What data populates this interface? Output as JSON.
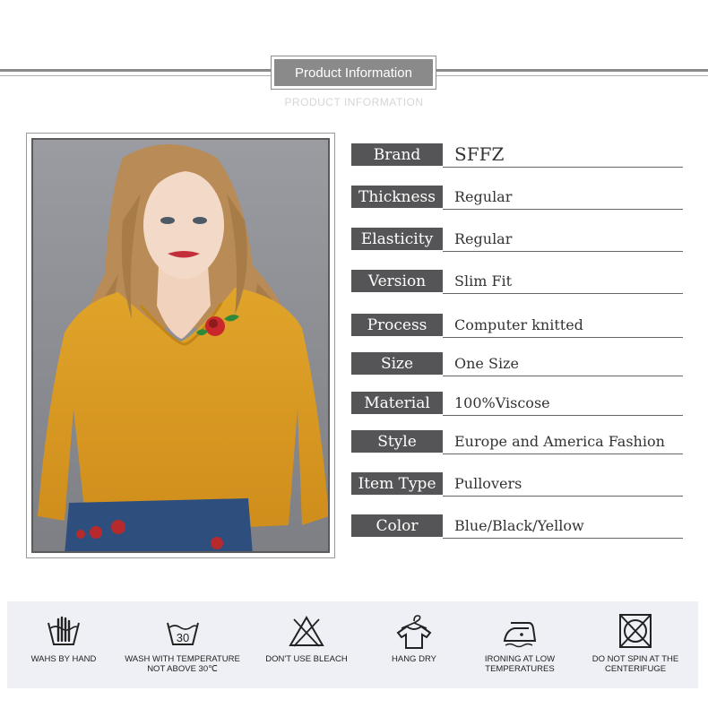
{
  "header": {
    "title": "Product Information",
    "subtitle": "PRODUCT INFORMATION"
  },
  "photo": {
    "icon": "model-photo",
    "description": "woman wearing yellow v-neck pullover with rose patch"
  },
  "specs": [
    {
      "label": "Brand",
      "value": "SFFZ"
    },
    {
      "label": "Thickness",
      "value": "Regular"
    },
    {
      "label": "Elasticity",
      "value": "Regular"
    },
    {
      "label": "Version",
      "value": "Slim Fit"
    },
    {
      "label": "Process",
      "value": "Computer knitted"
    },
    {
      "label": "Size",
      "value": "One Size"
    },
    {
      "label": "Material",
      "value": "100%Viscose"
    },
    {
      "label": "Style",
      "value": "Europe and America Fashion"
    },
    {
      "label": "Item Type",
      "value": "Pullovers"
    },
    {
      "label": "Color",
      "value": "Blue/Black/Yellow"
    }
  ],
  "care": [
    {
      "icon": "hand-wash-icon",
      "line1": "WAHS BY HAND",
      "line2": ""
    },
    {
      "icon": "wash-30-icon",
      "line1": "WASH WITH TEMPERATURE",
      "line2": "NOT ABOVE 30℃",
      "badge": "30"
    },
    {
      "icon": "no-bleach-icon",
      "line1": "DON'T USE BLEACH",
      "line2": ""
    },
    {
      "icon": "hang-dry-icon",
      "line1": "HANG DRY",
      "line2": ""
    },
    {
      "icon": "iron-low-icon",
      "line1": "IRONING AT LOW",
      "line2": "TEMPERATURES"
    },
    {
      "icon": "no-spin-icon",
      "line1": "DO NOT SPIN AT THE",
      "line2": "CENTERIFUGE"
    }
  ],
  "colors": {
    "label_bg": "#555557",
    "header_bg": "#8a8a8a",
    "care_bg": "#eef0f5",
    "sweater": "#d99a22"
  }
}
